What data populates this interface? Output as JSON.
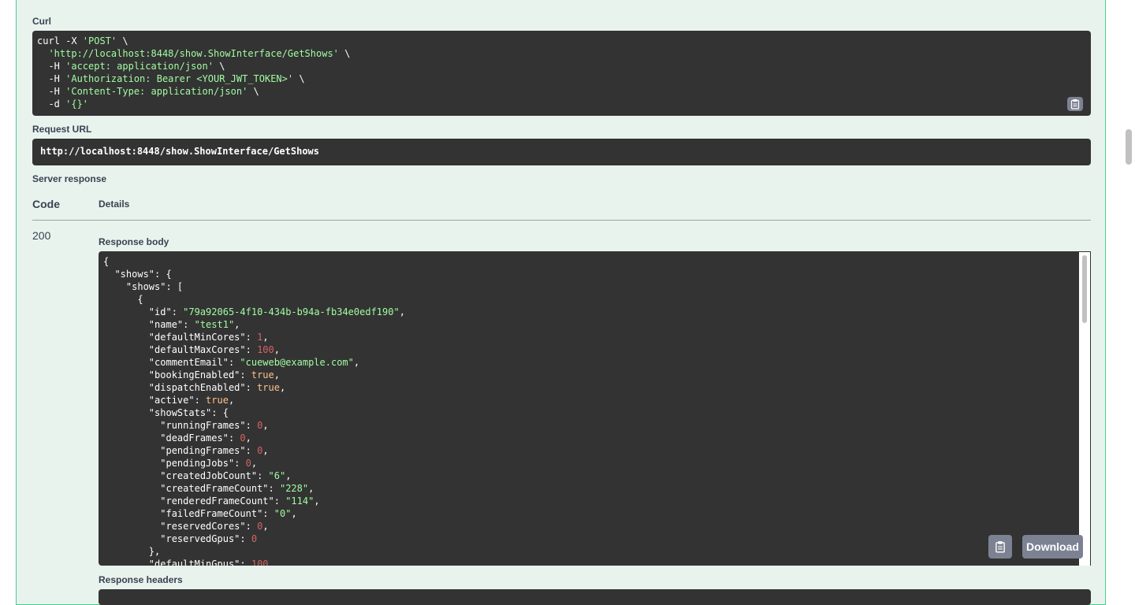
{
  "labels": {
    "curl": "Curl",
    "request_url": "Request URL",
    "server_response": "Server response",
    "code": "Code",
    "details": "Details",
    "response_body": "Response body",
    "response_headers": "Response headers"
  },
  "curl_lines": [
    [
      {
        "t": "curl -X ",
        "c": ""
      },
      {
        "t": "'POST'",
        "c": "str"
      },
      {
        "t": " \\",
        "c": ""
      }
    ],
    [
      {
        "t": "  ",
        "c": ""
      },
      {
        "t": "'http://localhost:8448/show.ShowInterface/GetShows'",
        "c": "str"
      },
      {
        "t": " \\",
        "c": ""
      }
    ],
    [
      {
        "t": "  -H ",
        "c": ""
      },
      {
        "t": "'accept: application/json'",
        "c": "str"
      },
      {
        "t": " \\",
        "c": ""
      }
    ],
    [
      {
        "t": "  -H ",
        "c": ""
      },
      {
        "t": "'Authorization: Bearer <YOUR_JWT_TOKEN>'",
        "c": "str"
      },
      {
        "t": " \\",
        "c": ""
      }
    ],
    [
      {
        "t": "  -H ",
        "c": ""
      },
      {
        "t": "'Content-Type: application/json'",
        "c": "str"
      },
      {
        "t": " \\",
        "c": ""
      }
    ],
    [
      {
        "t": "  -d ",
        "c": ""
      },
      {
        "t": "'{}'",
        "c": "str"
      }
    ]
  ],
  "request_url": "http://localhost:8448/show.ShowInterface/GetShows",
  "response": {
    "code": "200",
    "download_label": "Download",
    "body_lines": [
      [
        {
          "t": "{",
          "c": ""
        }
      ],
      [
        {
          "t": "  \"shows\": {",
          "c": ""
        }
      ],
      [
        {
          "t": "    \"shows\": [",
          "c": ""
        }
      ],
      [
        {
          "t": "      {",
          "c": ""
        }
      ],
      [
        {
          "t": "        \"id\": ",
          "c": ""
        },
        {
          "t": "\"79a92065-4f10-434b-b94a-fb34e0edf190\"",
          "c": "str"
        },
        {
          "t": ",",
          "c": ""
        }
      ],
      [
        {
          "t": "        \"name\": ",
          "c": ""
        },
        {
          "t": "\"test1\"",
          "c": "str"
        },
        {
          "t": ",",
          "c": ""
        }
      ],
      [
        {
          "t": "        \"defaultMinCores\": ",
          "c": ""
        },
        {
          "t": "1",
          "c": "num"
        },
        {
          "t": ",",
          "c": ""
        }
      ],
      [
        {
          "t": "        \"defaultMaxCores\": ",
          "c": ""
        },
        {
          "t": "100",
          "c": "num"
        },
        {
          "t": ",",
          "c": ""
        }
      ],
      [
        {
          "t": "        \"commentEmail\": ",
          "c": ""
        },
        {
          "t": "\"cueweb@example.com\"",
          "c": "str"
        },
        {
          "t": ",",
          "c": ""
        }
      ],
      [
        {
          "t": "        \"bookingEnabled\": ",
          "c": ""
        },
        {
          "t": "true",
          "c": "kw"
        },
        {
          "t": ",",
          "c": ""
        }
      ],
      [
        {
          "t": "        \"dispatchEnabled\": ",
          "c": ""
        },
        {
          "t": "true",
          "c": "kw"
        },
        {
          "t": ",",
          "c": ""
        }
      ],
      [
        {
          "t": "        \"active\": ",
          "c": ""
        },
        {
          "t": "true",
          "c": "kw"
        },
        {
          "t": ",",
          "c": ""
        }
      ],
      [
        {
          "t": "        \"showStats\": {",
          "c": ""
        }
      ],
      [
        {
          "t": "          \"runningFrames\": ",
          "c": ""
        },
        {
          "t": "0",
          "c": "num"
        },
        {
          "t": ",",
          "c": ""
        }
      ],
      [
        {
          "t": "          \"deadFrames\": ",
          "c": ""
        },
        {
          "t": "0",
          "c": "num"
        },
        {
          "t": ",",
          "c": ""
        }
      ],
      [
        {
          "t": "          \"pendingFrames\": ",
          "c": ""
        },
        {
          "t": "0",
          "c": "num"
        },
        {
          "t": ",",
          "c": ""
        }
      ],
      [
        {
          "t": "          \"pendingJobs\": ",
          "c": ""
        },
        {
          "t": "0",
          "c": "num"
        },
        {
          "t": ",",
          "c": ""
        }
      ],
      [
        {
          "t": "          \"createdJobCount\": ",
          "c": ""
        },
        {
          "t": "\"6\"",
          "c": "str"
        },
        {
          "t": ",",
          "c": ""
        }
      ],
      [
        {
          "t": "          \"createdFrameCount\": ",
          "c": ""
        },
        {
          "t": "\"228\"",
          "c": "str"
        },
        {
          "t": ",",
          "c": ""
        }
      ],
      [
        {
          "t": "          \"renderedFrameCount\": ",
          "c": ""
        },
        {
          "t": "\"114\"",
          "c": "str"
        },
        {
          "t": ",",
          "c": ""
        }
      ],
      [
        {
          "t": "          \"failedFrameCount\": ",
          "c": ""
        },
        {
          "t": "\"0\"",
          "c": "str"
        },
        {
          "t": ",",
          "c": ""
        }
      ],
      [
        {
          "t": "          \"reservedCores\": ",
          "c": ""
        },
        {
          "t": "0",
          "c": "num"
        },
        {
          "t": ",",
          "c": ""
        }
      ],
      [
        {
          "t": "          \"reservedGpus\": ",
          "c": ""
        },
        {
          "t": "0",
          "c": "num"
        }
      ],
      [
        {
          "t": "        },",
          "c": ""
        }
      ],
      [
        {
          "t": "        \"defaultMinGpus\": ",
          "c": ""
        },
        {
          "t": "100",
          "c": "num"
        }
      ]
    ]
  },
  "icons": {
    "copy": "clipboard-icon"
  },
  "colors": {
    "panel_bg": "#e8f3ee",
    "panel_border": "#49cc90",
    "code_bg": "#333333",
    "string": "#a2fca2",
    "number": "#d36363",
    "keyword": "#fcc28c",
    "button": "#7d8293"
  }
}
